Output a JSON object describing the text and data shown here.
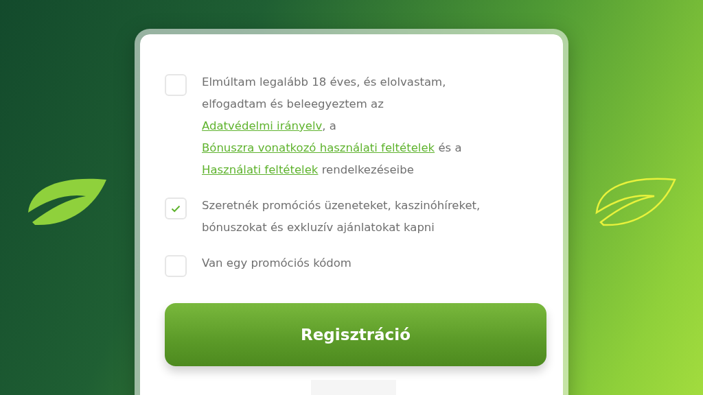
{
  "consents": [
    {
      "checked": false,
      "parts": [
        {
          "kind": "text",
          "text": "Elmúltam legalább 18 éves, és elolvastam, elfogadtam és beleegyeztem az "
        },
        {
          "kind": "link",
          "text": "Adatvédelmi irányelv"
        },
        {
          "kind": "text",
          "text": ", a "
        },
        {
          "kind": "link",
          "text": "Bónuszra vonatkozó használati feltételek"
        },
        {
          "kind": "text",
          "text": " és a "
        },
        {
          "kind": "link",
          "text": "Használati feltételek"
        },
        {
          "kind": "text",
          "text": " rendelkezéseibe"
        }
      ]
    },
    {
      "checked": true,
      "parts": [
        {
          "kind": "text",
          "text": "Szeretnék promóciós üzeneteket, kaszinóhíreket, bónuszokat és exkluzív ajánlatokat kapni"
        }
      ]
    },
    {
      "checked": false,
      "parts": [
        {
          "kind": "text",
          "text": "Van egy promóciós kódom"
        }
      ]
    }
  ],
  "register_button": "Regisztráció"
}
